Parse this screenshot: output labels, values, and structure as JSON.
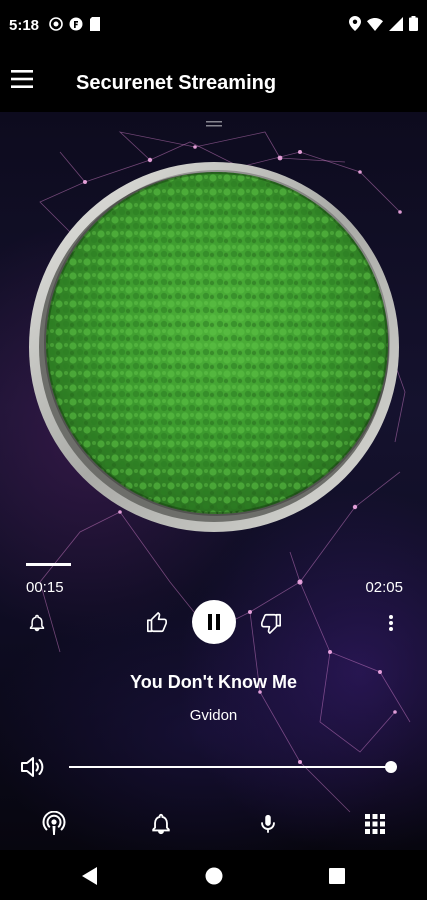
{
  "status_bar": {
    "time": "5:18"
  },
  "app_bar": {
    "title": "Securenet Streaming"
  },
  "player": {
    "progress_fraction": 0.12,
    "elapsed": "00:15",
    "duration": "02:05",
    "track_title": "You Don't Know Me",
    "artist": "Gvidon",
    "volume_fraction": 1.0,
    "state": "playing"
  },
  "bottom_tabs": [
    "podcast-icon",
    "bell-icon",
    "microphone-icon",
    "grid-icon"
  ],
  "colors": {
    "background": "#000000",
    "accent": "#ffffff",
    "album_green": "#3c9a2e"
  }
}
